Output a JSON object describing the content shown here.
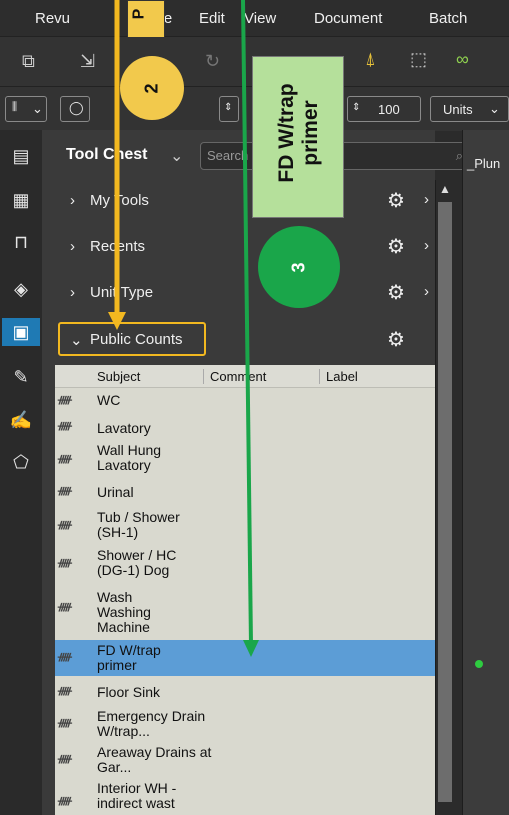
{
  "menu": [
    "Revu",
    "File",
    "Edit",
    "View",
    "Document",
    "Batch"
  ],
  "toolbar": {
    "zoom_value": "100",
    "units_label": "Units"
  },
  "panel": {
    "title": "Tool Chest",
    "search_placeholder": "Search",
    "sections": [
      {
        "label": "My Tools"
      },
      {
        "label": "Recents"
      },
      {
        "label": "Unit Type"
      },
      {
        "label": "Public Counts"
      }
    ],
    "columns": [
      "Subject",
      "Comment",
      "Label"
    ],
    "rows": [
      {
        "subject": "WC"
      },
      {
        "subject": "Lavatory"
      },
      {
        "subject": "Wall Hung Lavatory"
      },
      {
        "subject": "Urinal"
      },
      {
        "subject": "Tub / Shower (SH-1)"
      },
      {
        "subject": "Shower / HC (DG-1) Dog"
      },
      {
        "subject": "Wash Washing Machine"
      },
      {
        "subject": "FD W/trap primer",
        "selected": true
      },
      {
        "subject": "Floor Sink"
      },
      {
        "subject": "Emergency Drain W/trap..."
      },
      {
        "subject": "Areaway Drains at Gar..."
      },
      {
        "subject": "Interior WH - indirect wast"
      }
    ]
  },
  "canvas": {
    "tab_label": "_Plun"
  },
  "annotations": {
    "badge_2": "2",
    "badge_3": "3",
    "note_text": "FD W/trap primer",
    "yellow_label": "P"
  },
  "colors": {
    "accent_blue": "#1f7ab4",
    "selection": "#5c9dd6",
    "yellow": "#f2c94c",
    "green": "#1aa64a",
    "note_green": "#b5e09b"
  }
}
